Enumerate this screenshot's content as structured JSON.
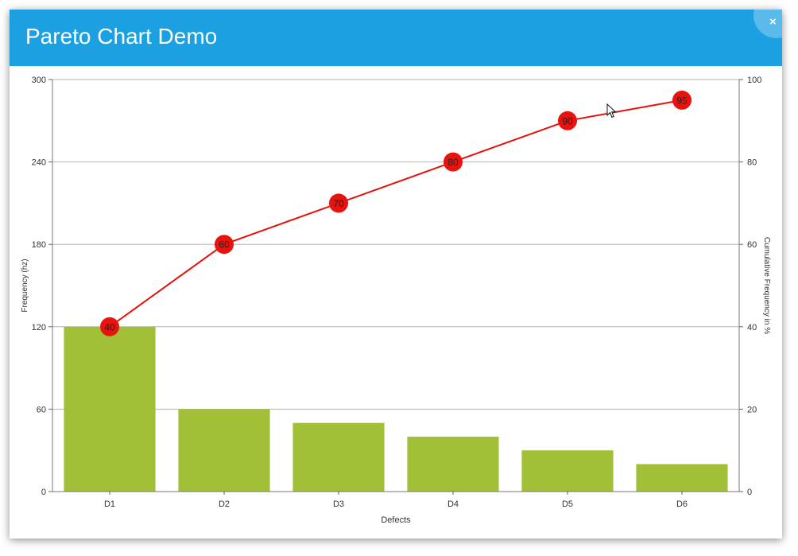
{
  "window": {
    "title": "Pareto Chart Demo",
    "close_icon": "×",
    "titlebar_color": "#1ba1e2"
  },
  "chart_data": {
    "type": "bar",
    "categories": [
      "D1",
      "D2",
      "D3",
      "D4",
      "D5",
      "D6"
    ],
    "series": [
      {
        "type": "bar",
        "axis": "left",
        "values": [
          120,
          60,
          50,
          40,
          30,
          20
        ],
        "color": "#a2c037"
      },
      {
        "type": "line",
        "axis": "right",
        "values": [
          40,
          60,
          70,
          80,
          90,
          95
        ],
        "color": "#e3120b",
        "marker_color": "#e8120f",
        "data_labels": [
          "40",
          "60",
          "70",
          "80",
          "90",
          "95"
        ]
      }
    ],
    "xlabel": "Defects",
    "ylabel": "Frequency (hz)",
    "y2label": "Cumulative Frequency in %",
    "ylim": [
      0,
      300
    ],
    "y2lim": [
      0,
      100
    ],
    "y_ticks": [
      "0",
      "60",
      "120",
      "180",
      "240",
      "300"
    ],
    "y2_ticks": [
      "0",
      "20",
      "40",
      "60",
      "80",
      "100"
    ],
    "grid": true
  }
}
